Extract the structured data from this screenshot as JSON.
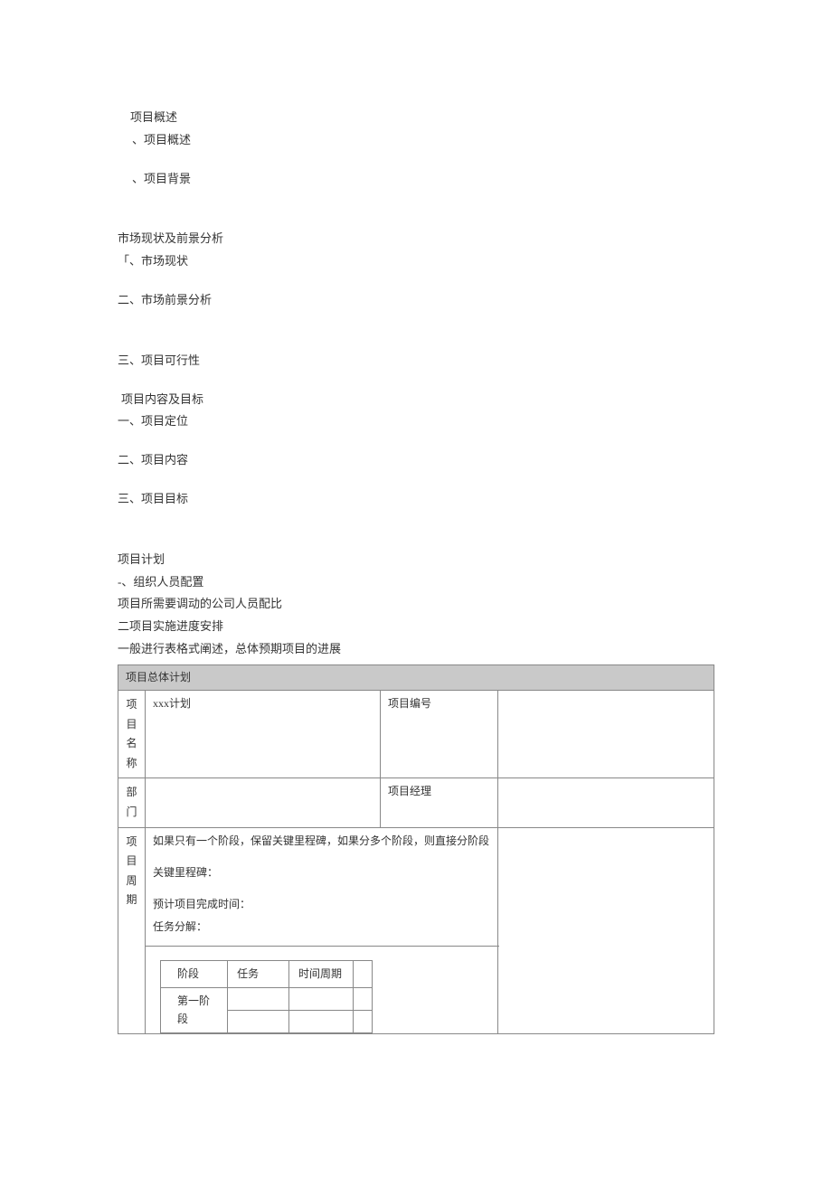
{
  "sections": {
    "s1": {
      "title": "项目概述",
      "i1": "、项目概述",
      "i2": "、项目背景"
    },
    "s2": {
      "title": "市场现状及前景分析",
      "i1": "「、市场现状",
      "i2": "二、市场前景分析",
      "i3": "三、项目可行性"
    },
    "s3": {
      "title": "项目内容及目标",
      "i1": "一、项目定位",
      "i2": "二、项目内容",
      "i3": "三、项目目标"
    },
    "s4": {
      "title": "项目计划",
      "i1": "-、组织人员配置",
      "note1": "项目所需要调动的公司人员配比",
      "i2": "二项目实施进度安排",
      "note2": "一般进行表格式阐述，总体预期项目的进展"
    }
  },
  "table": {
    "header": "项目总体计划",
    "row1": {
      "label": "项目名称",
      "val": "xxx计划",
      "label2": "项目编号",
      "val2": ""
    },
    "row2": {
      "label": "部门",
      "val": "",
      "label2": "项目经理",
      "val2": ""
    },
    "period": {
      "label": "项目周期",
      "desc": "如果只有一个阶段，保留关键里程碑，如果分多个阶段，则直接分阶段",
      "l2": "关键里程碑：",
      "l3": "预计项目完成时间：",
      "l4": "任务分解：",
      "inner": {
        "h1": "阶段",
        "h2": "任务",
        "h3": "时间周期",
        "h4": "",
        "r1c1": "第一阶段"
      }
    }
  }
}
